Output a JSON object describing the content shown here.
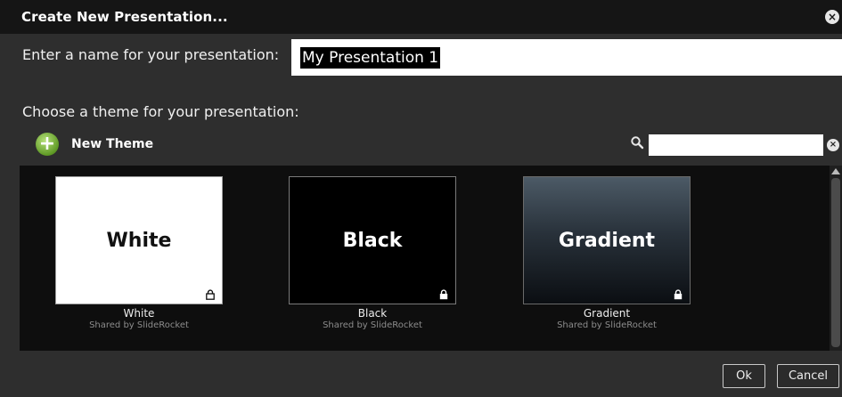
{
  "dialog": {
    "title": "Create New Presentation...",
    "close_glyph": "×"
  },
  "name_field": {
    "label": "Enter a name for your presentation:",
    "value": "My Presentation 1"
  },
  "theme_section": {
    "label": "Choose a theme for your presentation:",
    "new_theme_label": "New Theme",
    "new_theme_icon": "plus-circle-icon",
    "search_icon": "search-icon",
    "search_value": "",
    "clear_glyph": "×"
  },
  "themes": [
    {
      "thumb_title": "White",
      "name": "White",
      "shared": "Shared by SlideRocket",
      "background": "#ffffff",
      "text_color": "#111111",
      "locked": true
    },
    {
      "thumb_title": "Black",
      "name": "Black",
      "shared": "Shared by SlideRocket",
      "background": "#000000",
      "text_color": "#ffffff",
      "locked": true
    },
    {
      "thumb_title": "Gradient",
      "name": "Gradient",
      "shared": "Shared by SlideRocket",
      "background": "gradient #4c5a66 to #0b0e12",
      "text_color": "#ffffff",
      "locked": true
    }
  ],
  "buttons": {
    "ok": "Ok",
    "cancel": "Cancel"
  },
  "colors": {
    "dialog_bg": "#2e2e2e",
    "titlebar_bg": "#151515",
    "gallery_bg": "#0e0e0e",
    "accent_green": "#5f9a25"
  }
}
